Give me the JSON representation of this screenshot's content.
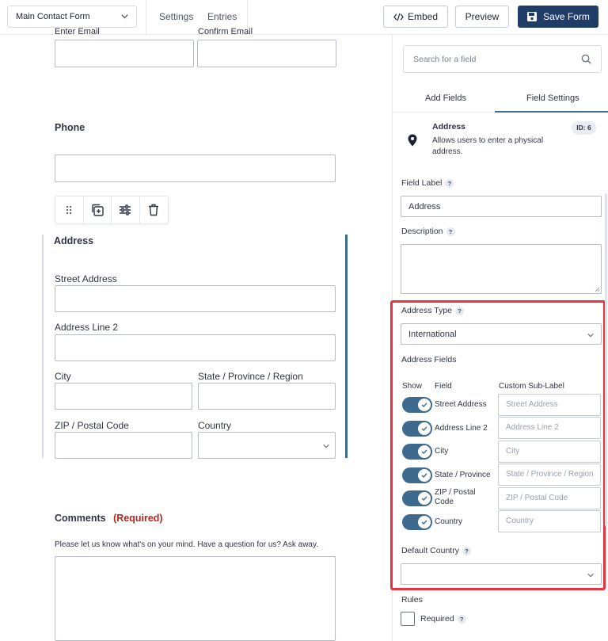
{
  "topbar": {
    "form_name": "Main Contact Form",
    "settings": "Settings",
    "entries": "Entries",
    "embed": "Embed",
    "preview": "Preview",
    "save": "Save Form"
  },
  "canvas": {
    "email_label": "Enter Email",
    "confirm_email_label": "Confirm Email",
    "phone_label": "Phone",
    "address_heading": "Address",
    "street_label": "Street Address",
    "line2_label": "Address Line 2",
    "city_label": "City",
    "state_label": "State / Province / Region",
    "zip_label": "ZIP / Postal Code",
    "country_label": "Country",
    "comments_label": "Comments",
    "comments_required": "(Required)",
    "comments_desc": "Please let us know what's on your mind. Have a question for us? Ask away."
  },
  "panel": {
    "search_placeholder": "Search for a field",
    "tab_add": "Add Fields",
    "tab_settings": "Field Settings",
    "field_title": "Address",
    "field_desc": "Allows users to enter a physical address.",
    "field_id": "ID: 6",
    "label_field_label": "Field Label",
    "field_label_value": "Address",
    "label_description": "Description",
    "label_address_type": "Address Type",
    "address_type_value": "International",
    "label_address_fields": "Address Fields",
    "col_show": "Show",
    "col_field": "Field",
    "col_sublabel": "Custom Sub-Label",
    "rows": [
      {
        "name": "Street Address",
        "placeholder": "Street Address"
      },
      {
        "name": "Address Line 2",
        "placeholder": "Address Line 2"
      },
      {
        "name": "City",
        "placeholder": "City"
      },
      {
        "name": "State / Province",
        "placeholder": "State / Province / Region"
      },
      {
        "name": "ZIP / Postal Code",
        "placeholder": "ZIP / Postal Code"
      },
      {
        "name": "Country",
        "placeholder": "Country"
      }
    ],
    "label_default_country": "Default Country",
    "label_rules": "Rules",
    "required_label": "Required"
  },
  "colors": {
    "accent": "#3e6a8e",
    "save_bg": "#1f3d66",
    "highlight": "#e8323f",
    "required": "#b3261e"
  },
  "icons": [
    "chevron-down-icon",
    "code-icon",
    "save-icon",
    "search-icon",
    "drag-handle-icon",
    "duplicate-icon",
    "settings-sliders-icon",
    "trash-icon",
    "map-pin-icon",
    "check-icon",
    "help-icon"
  ]
}
